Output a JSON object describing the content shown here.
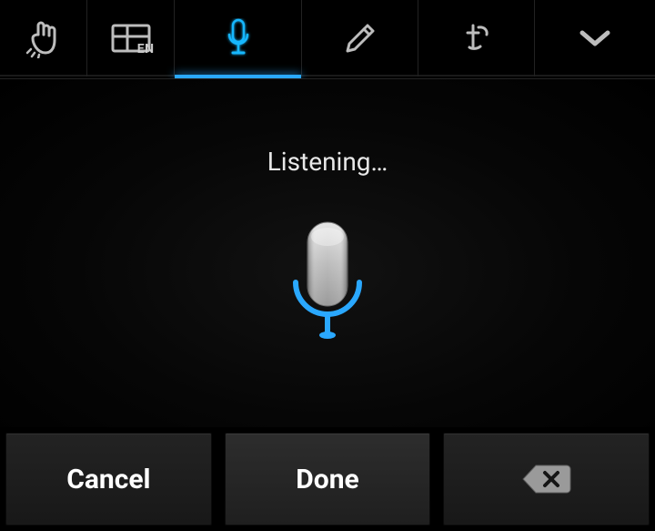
{
  "tabs": {
    "handwriting_lang": "EN"
  },
  "main": {
    "status_text": "Listening…"
  },
  "footer": {
    "cancel_label": "Cancel",
    "done_label": "Done"
  },
  "colors": {
    "accent": "#2aa8ff",
    "icon_gray": "#bdbdbd"
  }
}
